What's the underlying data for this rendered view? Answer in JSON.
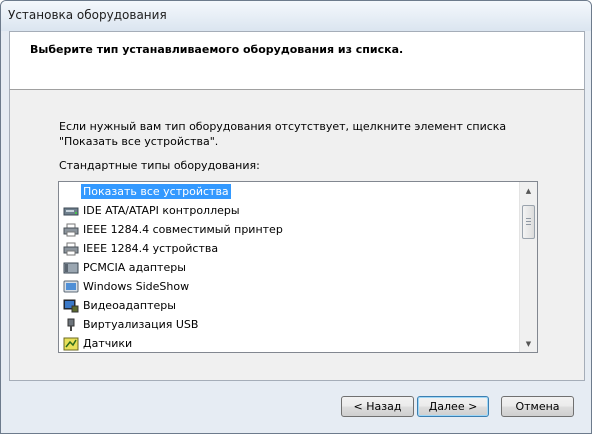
{
  "window": {
    "title": "Установка оборудования"
  },
  "header": {
    "text": "Выберите тип устанавливаемого оборудования из списка."
  },
  "content": {
    "description": "Если нужный вам тип оборудования отсутствует, щелкните элемент списка \"Показать все устройства\".",
    "list_label": "Стандартные типы оборудования:"
  },
  "list": {
    "items": [
      {
        "label": "Показать все устройства",
        "icon": "none",
        "selected": true
      },
      {
        "label": "IDE ATA/ATAPI контроллеры",
        "icon": "ide-controller-icon"
      },
      {
        "label": "IEEE 1284.4 совместимый принтер",
        "icon": "printer-icon"
      },
      {
        "label": "IEEE 1284.4 устройства",
        "icon": "printer-icon"
      },
      {
        "label": "PCMCIA адаптеры",
        "icon": "pcmcia-card-icon"
      },
      {
        "label": "Windows SideShow",
        "icon": "sideshow-icon"
      },
      {
        "label": "Видеоадаптеры",
        "icon": "display-adapter-icon"
      },
      {
        "label": "Виртуализация USB",
        "icon": "usb-plug-icon"
      },
      {
        "label": "Датчики",
        "icon": "sensor-icon"
      }
    ]
  },
  "buttons": {
    "back": "< Назад",
    "next": "Далее >",
    "cancel": "Отмена"
  },
  "colors": {
    "selection": "#3399ff",
    "window_bg": "#e6ecf3"
  }
}
